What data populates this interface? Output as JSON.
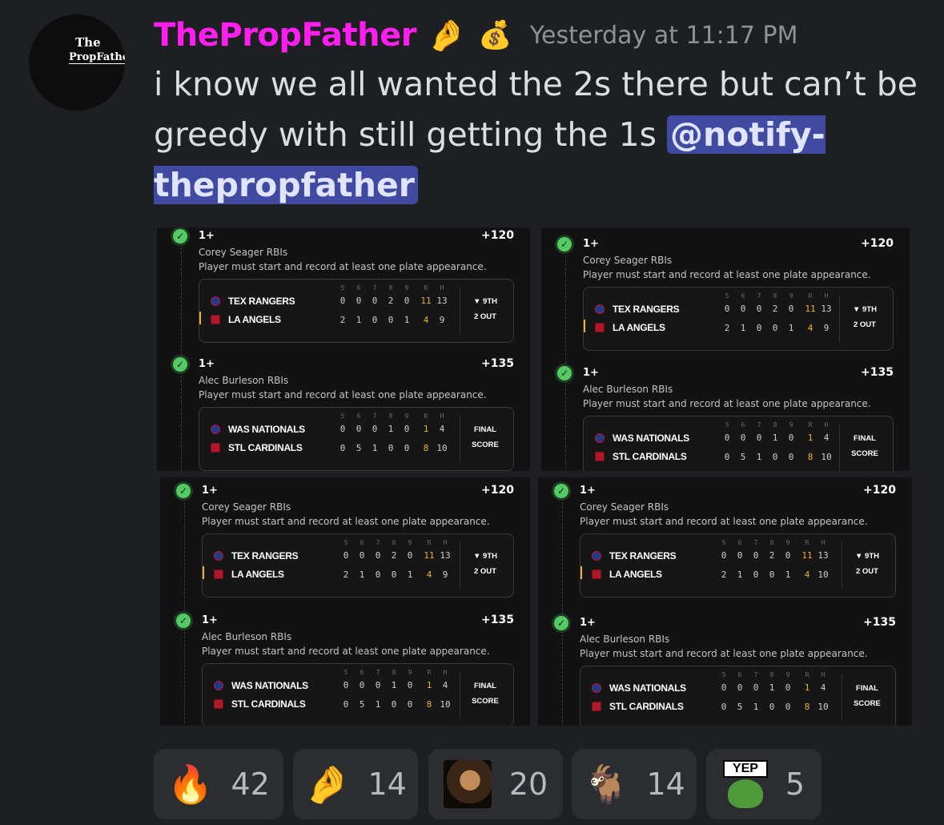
{
  "message": {
    "username": "ThePropFather",
    "badge_emojis": [
      "🤌",
      "💰"
    ],
    "timestamp": "Yesterday at 11:17 PM",
    "text": "i know we all wanted the 2s there but can’t be greedy with still getting the 1s ",
    "mention": "@notify-thepropfather",
    "avatar": {
      "line1": "The",
      "line2": "PropFather"
    },
    "username_color": "#ff1ef0",
    "mention_bg": "#3f4aa0"
  },
  "screenshots": [
    {
      "bets": [
        {
          "tier": "1+",
          "odds": "+120",
          "market": "Corey Seager RBIs",
          "rule": "Player must start and record at least one plate appearance.",
          "game": {
            "team1": "TEX RANGERS",
            "team2": "LA ANGELS",
            "innings_header": [
              "5",
              "6",
              "7",
              "8",
              "9",
              "R",
              "H"
            ],
            "line1": [
              "0",
              "0",
              "0",
              "2",
              "0",
              "11",
              "13"
            ],
            "line2": [
              "2",
              "1",
              "0",
              "0",
              "1",
              "4",
              "9"
            ],
            "status1": "▼ 9TH",
            "status2": "2 OUT",
            "possession": true
          }
        },
        {
          "tier": "1+",
          "odds": "+135",
          "market": "Alec Burleson RBIs",
          "rule": "Player must start and record at least one plate appearance.",
          "game": {
            "team1": "WAS NATIONALS",
            "team2": "STL CARDINALS",
            "innings_header": [
              "5",
              "6",
              "7",
              "8",
              "9",
              "R",
              "H"
            ],
            "line1": [
              "0",
              "0",
              "0",
              "1",
              "0",
              "1",
              "4"
            ],
            "line2": [
              "0",
              "5",
              "1",
              "0",
              "0",
              "8",
              "10"
            ],
            "status1": "FINAL",
            "status2": "SCORE",
            "possession": false
          }
        }
      ]
    },
    {
      "bets": [
        {
          "tier": "1+",
          "odds": "+120",
          "market": "Corey Seager RBIs",
          "rule": "Player must start and record at least one plate appearance.",
          "game": {
            "team1": "TEX RANGERS",
            "team2": "LA ANGELS",
            "innings_header": [
              "5",
              "6",
              "7",
              "8",
              "9",
              "R",
              "H"
            ],
            "line1": [
              "0",
              "0",
              "0",
              "2",
              "0",
              "11",
              "13"
            ],
            "line2": [
              "2",
              "1",
              "0",
              "0",
              "1",
              "4",
              "9"
            ],
            "status1": "▼ 9TH",
            "status2": "2 OUT",
            "possession": true
          }
        },
        {
          "tier": "1+",
          "odds": "+135",
          "market": "Alec Burleson RBIs",
          "rule": "Player must start and record at least one plate appearance.",
          "game": {
            "team1": "WAS NATIONALS",
            "team2": "STL CARDINALS",
            "innings_header": [
              "5",
              "6",
              "7",
              "8",
              "9",
              "R",
              "H"
            ],
            "line1": [
              "0",
              "0",
              "0",
              "1",
              "0",
              "1",
              "4"
            ],
            "line2": [
              "0",
              "5",
              "1",
              "0",
              "0",
              "8",
              "10"
            ],
            "status1": "FINAL",
            "status2": "SCORE",
            "possession": false
          }
        }
      ]
    },
    {
      "bets": [
        {
          "tier": "1+",
          "odds": "+120",
          "market": "Corey Seager RBIs",
          "rule": "Player must start and record at least one plate appearance.",
          "game": {
            "team1": "TEX RANGERS",
            "team2": "LA ANGELS",
            "innings_header": [
              "5",
              "6",
              "7",
              "8",
              "9",
              "R",
              "H"
            ],
            "line1": [
              "0",
              "0",
              "0",
              "2",
              "0",
              "11",
              "13"
            ],
            "line2": [
              "2",
              "1",
              "0",
              "0",
              "1",
              "4",
              "9"
            ],
            "status1": "▼ 9TH",
            "status2": "2 OUT",
            "possession": true
          }
        },
        {
          "tier": "1+",
          "odds": "+135",
          "market": "Alec Burleson RBIs",
          "rule": "Player must start and record at least one plate appearance.",
          "game": {
            "team1": "WAS NATIONALS",
            "team2": "STL CARDINALS",
            "innings_header": [
              "5",
              "6",
              "7",
              "8",
              "9",
              "R",
              "H"
            ],
            "line1": [
              "0",
              "0",
              "0",
              "1",
              "0",
              "1",
              "4"
            ],
            "line2": [
              "0",
              "5",
              "1",
              "0",
              "0",
              "8",
              "10"
            ],
            "status1": "FINAL",
            "status2": "SCORE",
            "possession": false
          }
        }
      ]
    },
    {
      "bets": [
        {
          "tier": "1+",
          "odds": "+120",
          "market": "Corey Seager RBIs",
          "rule": "Player must start and record at least one plate appearance.",
          "game": {
            "team1": "TEX RANGERS",
            "team2": "LA ANGELS",
            "innings_header": [
              "5",
              "6",
              "7",
              "8",
              "9",
              "R",
              "H"
            ],
            "line1": [
              "0",
              "0",
              "0",
              "2",
              "0",
              "11",
              "13"
            ],
            "line2": [
              "2",
              "1",
              "0",
              "0",
              "1",
              "4",
              "10"
            ],
            "status1": "▼ 9TH",
            "status2": "2 OUT",
            "possession": true
          }
        },
        {
          "tier": "1+",
          "odds": "+135",
          "market": "Alec Burleson RBIs",
          "rule": "Player must start and record at least one plate appearance.",
          "game": {
            "team1": "WAS NATIONALS",
            "team2": "STL CARDINALS",
            "innings_header": [
              "5",
              "6",
              "7",
              "8",
              "9",
              "R",
              "H"
            ],
            "line1": [
              "0",
              "0",
              "0",
              "1",
              "0",
              "1",
              "4"
            ],
            "line2": [
              "0",
              "5",
              "1",
              "0",
              "0",
              "8",
              "10"
            ],
            "status1": "FINAL",
            "status2": "SCORE",
            "possession": false
          }
        }
      ]
    }
  ],
  "reactions": [
    {
      "emoji": "🔥",
      "name": "fire-reaction",
      "count": "42"
    },
    {
      "emoji": "🤌",
      "name": "pinched-fingers-reaction",
      "count": "14"
    },
    {
      "emoji": "",
      "name": "godfather-reaction",
      "count": "20"
    },
    {
      "emoji": "🐐",
      "name": "goat-reaction",
      "count": "14"
    },
    {
      "emoji": "",
      "name": "yep-reaction",
      "count": "5",
      "sign": "YEP"
    }
  ],
  "colors": {
    "runs_highlight": "#f0b02a",
    "check_green": "#54c964",
    "background": "#1e1f23"
  }
}
